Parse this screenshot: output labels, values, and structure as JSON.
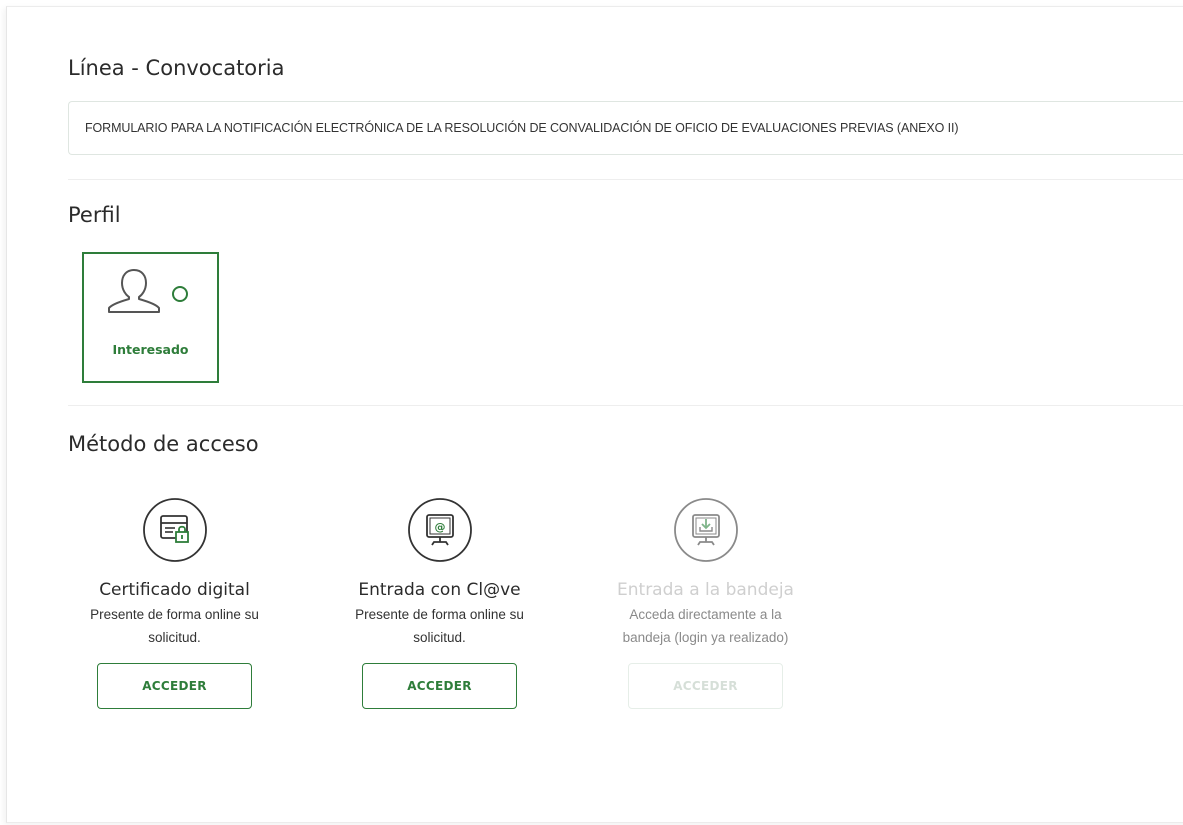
{
  "linea": {
    "title": "Línea - Convocatoria",
    "value": "FORMULARIO PARA LA NOTIFICACIÓN ELECTRÓNICA DE LA RESOLUCIÓN DE CONVALIDACIÓN DE OFICIO DE EVALUACIONES PREVIAS (ANEXO II)"
  },
  "perfil": {
    "title": "Perfil",
    "options": [
      {
        "label": "Interesado",
        "icon": "user-icon",
        "selected": false
      }
    ]
  },
  "metodo": {
    "title": "Método de acceso",
    "methods": [
      {
        "title": "Certificado digital",
        "description": "Presente de forma online su solicitud.",
        "button": "ACCEDER",
        "icon": "certificate-icon",
        "enabled": true
      },
      {
        "title": "Entrada con Cl@ve",
        "description": "Presente de forma online su solicitud.",
        "button": "ACCEDER",
        "icon": "clave-monitor-icon",
        "enabled": true
      },
      {
        "title": "Entrada a la bandeja",
        "description": "Acceda directamente a la bandeja (login ya realizado)",
        "button": "ACCEDER",
        "icon": "inbox-monitor-icon",
        "enabled": false
      }
    ]
  },
  "colors": {
    "accent": "#2e7d3a",
    "text": "#2b2b2b",
    "disabled_text": "#cfcfcf"
  }
}
